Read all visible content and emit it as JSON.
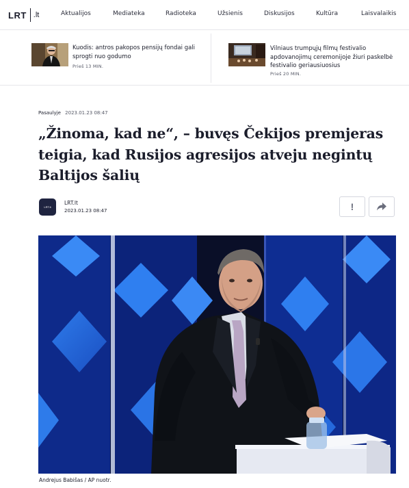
{
  "logo": {
    "brand": "LRT",
    "suffix": ".lt"
  },
  "nav": {
    "items": [
      "Aktualijos",
      "Mediateka",
      "Radioteka",
      "Užsienis",
      "Diskusijos",
      "Kultūra",
      "Laisvalaikis"
    ]
  },
  "teasers": [
    {
      "title": "Kuodis: antros pakopos pensijų fondai gali sprogti nuo godumo",
      "time": "Prieš 13 MIN."
    },
    {
      "title": "Vilniaus trumpųjų filmų festivalio apdovanojimų ceremonijoje žiuri paskelbė festivalio geriausiuosius",
      "time": "Prieš 20 MIN."
    }
  ],
  "article": {
    "category": "Pasaulyje",
    "date": "2023.01.23 08:47",
    "headline": "„Žinoma, kad ne“, – buvęs Čekijos premjeras teigia, kad Rusijos agresijos atveju negintų Baltijos šalių",
    "author": "LRT.lt",
    "author_date": "2023.01.23 08:47",
    "avatar_label": "LRT.lt",
    "report_label": "!",
    "photo_caption": "Andrejus Babišas / AP nuotr."
  },
  "icons": {
    "report": "exclamation-icon",
    "share": "share-arrow-icon"
  },
  "colors": {
    "text": "#1b1d2b",
    "border": "#d4d6de",
    "avatar": "#1f2440",
    "photo_bg": "#0b1640"
  }
}
